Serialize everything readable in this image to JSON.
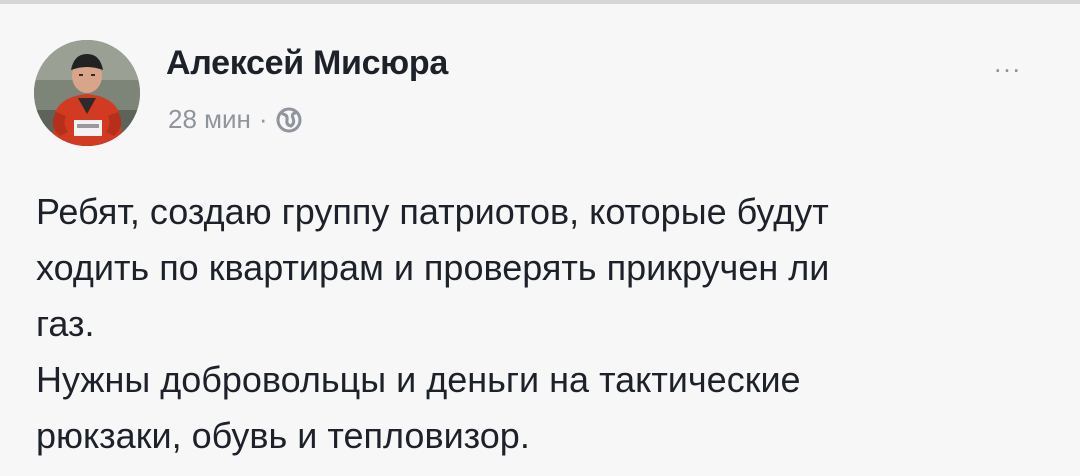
{
  "post": {
    "author": "Алексей Мисюра",
    "time": "28 мин",
    "separator": "·",
    "privacy_icon": "globe-icon",
    "menu_label": "...",
    "lines": [
      "Ребят, создаю группу патриотов, которые будут",
      "ходить по квартирам и проверять прикручен ли",
      "газ.",
      "Нужны добровольцы и деньги на тактические",
      "рюкзаки, обувь и тепловизор."
    ]
  },
  "colors": {
    "background": "#f7f7f7",
    "text": "#1d2129",
    "meta": "#90949c",
    "accent_jacket": "#d23a22"
  }
}
